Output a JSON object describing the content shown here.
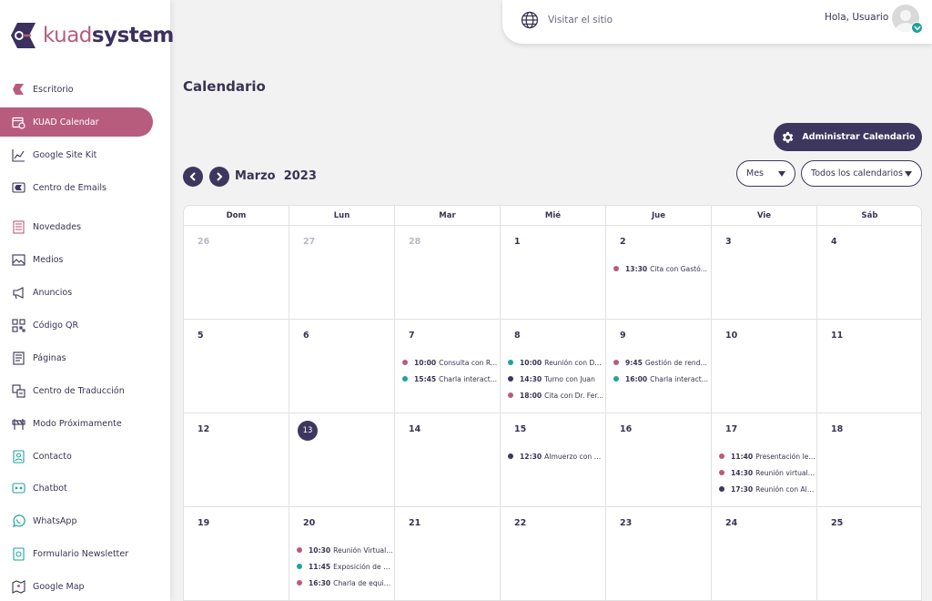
{
  "colors": {
    "accent": "#b85c7e",
    "primary": "#3d3760",
    "teal": "#1fa39a",
    "text": "#3a3352"
  },
  "brand": {
    "part1": "kuad",
    "part2": "system"
  },
  "sidebar": {
    "items": [
      {
        "label": "Escritorio",
        "icon": "dashboard-icon"
      },
      {
        "label": "KUAD Calendar",
        "icon": "calendar-icon",
        "active": true
      },
      {
        "label": "Google Site Kit",
        "icon": "chart-icon"
      },
      {
        "label": "Centro de Emails",
        "icon": "email-icon"
      },
      {
        "label": "Novedades",
        "icon": "news-icon"
      },
      {
        "label": "Medios",
        "icon": "media-icon"
      },
      {
        "label": "Anuncios",
        "icon": "megaphone-icon"
      },
      {
        "label": "Código QR",
        "icon": "qr-icon"
      },
      {
        "label": "Páginas",
        "icon": "pages-icon"
      },
      {
        "label": "Centro de Traducción",
        "icon": "translate-icon"
      },
      {
        "label": "Modo Próximamente",
        "icon": "barrier-icon"
      },
      {
        "label": "Contacto",
        "icon": "contact-icon"
      },
      {
        "label": "Chatbot",
        "icon": "chatbot-icon"
      },
      {
        "label": "WhatsApp",
        "icon": "whatsapp-icon"
      },
      {
        "label": "Formulario Newsletter",
        "icon": "newsletter-icon"
      },
      {
        "label": "Google Map",
        "icon": "map-icon"
      }
    ]
  },
  "topbar": {
    "visit": "Visitar el sitio",
    "greeting": "Hola, Usuario"
  },
  "page": {
    "title": "Calendario"
  },
  "toolbar": {
    "admin_label": "Administrar Calendario",
    "month": "Marzo",
    "year": "2023",
    "view_select": "Mes",
    "calendar_select": "Todos los calendarios"
  },
  "calendar": {
    "weekdays": [
      "Dom",
      "Lun",
      "Mar",
      "Mié",
      "Jue",
      "Vie",
      "Sáb"
    ],
    "today": "13",
    "weeks": [
      [
        {
          "day": "26",
          "muted": true
        },
        {
          "day": "27",
          "muted": true
        },
        {
          "day": "28",
          "muted": true
        },
        {
          "day": "1"
        },
        {
          "day": "2",
          "events": [
            {
              "time": "13:30",
              "title": "Cita con Gastó...",
              "color": "#b85c7e"
            }
          ]
        },
        {
          "day": "3"
        },
        {
          "day": "4"
        }
      ],
      [
        {
          "day": "5"
        },
        {
          "day": "6"
        },
        {
          "day": "7",
          "events": [
            {
              "time": "10:00",
              "title": "Consulta con R...",
              "color": "#b85c7e"
            },
            {
              "time": "15:45",
              "title": "Charla interact...",
              "color": "#1fa39a"
            }
          ]
        },
        {
          "day": "8",
          "events": [
            {
              "time": "10:00",
              "title": "Reunión con Da...",
              "color": "#1fa39a"
            },
            {
              "time": "14:30",
              "title": "Turno con Juan",
              "color": "#3d3760"
            },
            {
              "time": "18:00",
              "title": "Cita con Dr. Fer...",
              "color": "#b85c7e"
            }
          ]
        },
        {
          "day": "9",
          "events": [
            {
              "time": "9:45",
              "title": "Gestión de rend...",
              "color": "#b85c7e"
            },
            {
              "time": "16:00",
              "title": "Charla interact...",
              "color": "#1fa39a"
            }
          ]
        },
        {
          "day": "10"
        },
        {
          "day": "11"
        }
      ],
      [
        {
          "day": "12"
        },
        {
          "day": "13",
          "today": true
        },
        {
          "day": "14"
        },
        {
          "day": "15",
          "events": [
            {
              "time": "12:30",
              "title": "Almuerzo con S...",
              "color": "#3d3760"
            }
          ]
        },
        {
          "day": "16"
        },
        {
          "day": "17",
          "events": [
            {
              "time": "11:40",
              "title": "Presentación leg...",
              "color": "#b85c7e"
            },
            {
              "time": "14:30",
              "title": "Reunión virtual ...",
              "color": "#b85c7e"
            },
            {
              "time": "17:30",
              "title": "Reunión con Alv...",
              "color": "#3d3760"
            }
          ]
        },
        {
          "day": "18"
        }
      ],
      [
        {
          "day": "19"
        },
        {
          "day": "20",
          "events": [
            {
              "time": "10:30",
              "title": "Reunión  Virtual...",
              "color": "#b85c7e"
            },
            {
              "time": "11:45",
              "title": "Exposición de da...",
              "color": "#1fa39a"
            },
            {
              "time": "16:30",
              "title": "Charla de equip...",
              "color": "#b85c7e"
            }
          ]
        },
        {
          "day": "21"
        },
        {
          "day": "22"
        },
        {
          "day": "23"
        },
        {
          "day": "24"
        },
        {
          "day": "25"
        }
      ]
    ]
  }
}
